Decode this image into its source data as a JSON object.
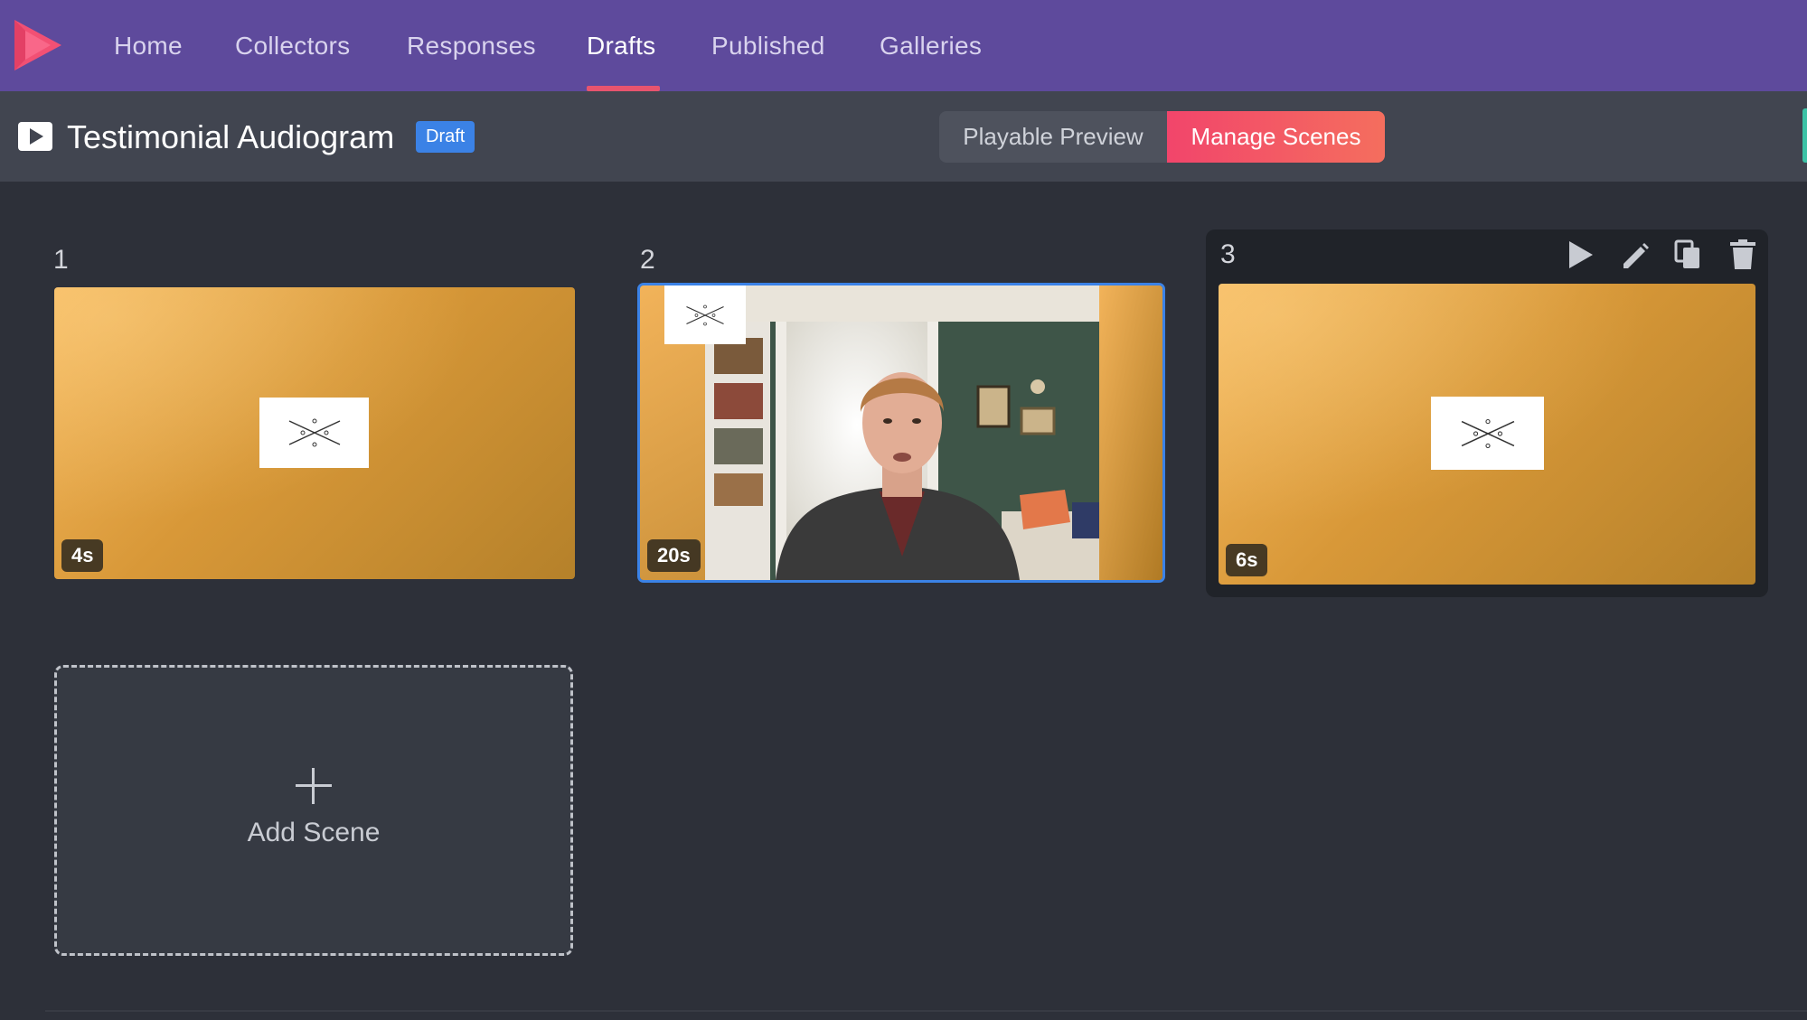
{
  "nav": {
    "items": [
      {
        "label": "Home"
      },
      {
        "label": "Collectors"
      },
      {
        "label": "Responses"
      },
      {
        "label": "Drafts",
        "active": true
      },
      {
        "label": "Published"
      },
      {
        "label": "Galleries"
      }
    ],
    "brand_color": "#5e4a9c",
    "accent_color": "#e8546e"
  },
  "header": {
    "title": "Testimonial Audiogram",
    "badge": "Draft",
    "toggle": {
      "preview_label": "Playable Preview",
      "manage_label": "Manage Scenes",
      "selected": "Manage Scenes"
    }
  },
  "scenes": [
    {
      "number": "1",
      "duration": "4s",
      "type": "logo"
    },
    {
      "number": "2",
      "duration": "20s",
      "type": "video",
      "selected": true
    },
    {
      "number": "3",
      "duration": "6s",
      "type": "logo",
      "hovered": true,
      "actions": [
        "play-icon",
        "pencil-icon",
        "duplicate-icon",
        "trash-icon"
      ]
    }
  ],
  "add_scene": {
    "label": "Add Scene",
    "icon": "plus-icon"
  }
}
